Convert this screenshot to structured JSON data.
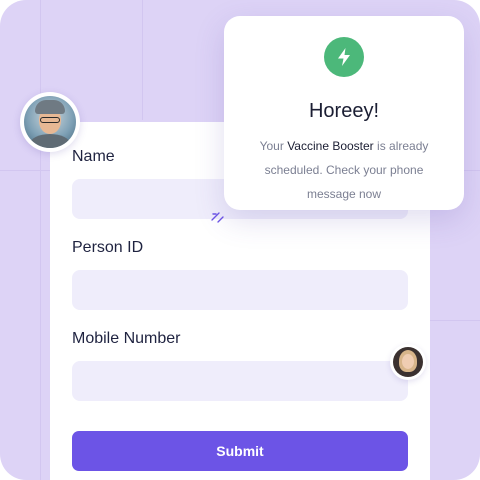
{
  "form": {
    "fields": [
      {
        "label": "Name",
        "value": "",
        "placeholder": ""
      },
      {
        "label": "Person ID",
        "value": "",
        "placeholder": ""
      },
      {
        "label": "Mobile Number",
        "value": "",
        "placeholder": ""
      }
    ],
    "submit_label": "Submit"
  },
  "toast": {
    "icon": "lightning-bolt-icon",
    "title": "Horeey!",
    "message_prefix": "Your",
    "message_highlight": "Vaccine Booster",
    "message_suffix": "is already scheduled. Check your phone message now"
  },
  "colors": {
    "background": "#ddd3f6",
    "accent": "#6c54e6",
    "success": "#4cb87a",
    "input_fill": "#efedfb"
  }
}
